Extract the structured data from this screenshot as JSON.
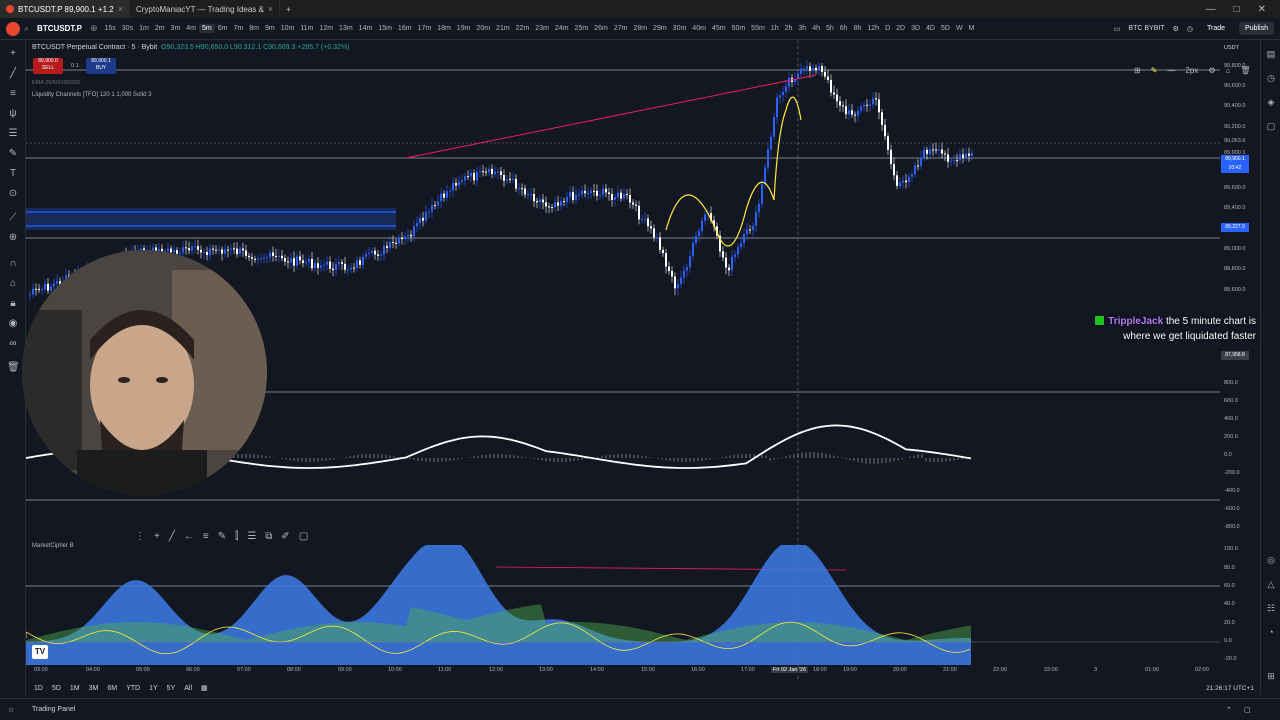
{
  "browser": {
    "tabs": [
      {
        "label": "BTCUSDT.P 89,900.1 +1.2",
        "active": true
      },
      {
        "label": "CryptoManiacYT — Trading Ideas &",
        "active": false
      }
    ],
    "new_tab": "+"
  },
  "toolbar": {
    "symbol": "BTCUSDT.P",
    "timeframes": [
      "15s",
      "30s",
      "1m",
      "2m",
      "3m",
      "4m",
      "5m",
      "6m",
      "7m",
      "8m",
      "9m",
      "10m",
      "11m",
      "12m",
      "13m",
      "14m",
      "15m",
      "16m",
      "17m",
      "18m",
      "19m",
      "20m",
      "21m",
      "22m",
      "23m",
      "24m",
      "25m",
      "26m",
      "27m",
      "28m",
      "29m",
      "30m",
      "40m",
      "45m",
      "50m",
      "55m",
      "1h",
      "2h",
      "3h",
      "4h",
      "5h",
      "6h",
      "8h",
      "12h",
      "D",
      "2D",
      "3D",
      "4D",
      "5D",
      "W",
      "M"
    ],
    "active_timeframe": "5m",
    "exchange_label": "BTC BYBIT",
    "trade_label": "Trade",
    "publish_label": "Publish"
  },
  "legend": {
    "title": "BTCUSDT Perpetual Contract · 5 · Bybit",
    "ohlc": "O90,323.5 H90,650.0 L90,312.1 C90,609.3 +285.7 (+0.32%)",
    "sell_price": "89,900.0",
    "sell_label": "SELL",
    "spread": "0.1",
    "buy_price": "89,900.1",
    "buy_label": "BUY",
    "ema_line": "EMA 20/50/100/200",
    "liquidity": "Liquidity Channels [TFO] 120 1 1,000 Solid 3",
    "marketcipher": "MarketCipher B"
  },
  "price_axis": {
    "currency": "USDT",
    "labels": [
      "90,800.0",
      "90,600.0",
      "90,400.0",
      "90,200.0",
      "90,063.6",
      "89,900.1",
      "89,600.0",
      "89,400.0",
      "89,227.9",
      "89,000.0",
      "88,800.0",
      "88,600.0"
    ],
    "current_price": "89,900.1",
    "current_countdown": "03:42",
    "level_price": "89,227.9",
    "crosshair_price": "87,958.8"
  },
  "macd_axis": [
    "800.0",
    "600.0",
    "400.0",
    "200.0",
    "0.0",
    "-200.0",
    "-400.0",
    "-600.0",
    "-800.0"
  ],
  "mc_axis": [
    "100.0",
    "80.0",
    "60.0",
    "40.0",
    "20.0",
    "0.0",
    "-20.0"
  ],
  "time_axis": [
    "03:00",
    "04:00",
    "05:00",
    "06:00",
    "07:00",
    "08:00",
    "09:00",
    "10:00",
    "11:00",
    "12:00",
    "13:00",
    "14:00",
    "15:00",
    "16:00",
    "17:00",
    "Fri 02 Jan '26",
    "18:00",
    "19:00",
    "20:00",
    "21:00",
    "22:00",
    "23:00",
    "3",
    "01:00",
    "02:00"
  ],
  "chat": {
    "user": "TrippleJack",
    "message": "the 5 minute chart is where we get liquidated faster"
  },
  "bottom": {
    "ranges": [
      "1D",
      "5D",
      "1M",
      "3M",
      "6M",
      "YTD",
      "1Y",
      "5Y",
      "All"
    ],
    "clock": "21:26:17 UTC+1",
    "trading_panel": "Trading Panel"
  },
  "drawing_toolbar": {
    "stroke_label": "2px"
  },
  "colors": {
    "background": "#131722",
    "candle_blue": "#2962ff",
    "macd_line": "#ffffff",
    "cipher_wave": "#3d7be8",
    "cipher_green": "#4caf50",
    "trend_line": "#e91e63",
    "yellow_line": "#ffeb3b",
    "chat_user": "#b57cf6"
  }
}
